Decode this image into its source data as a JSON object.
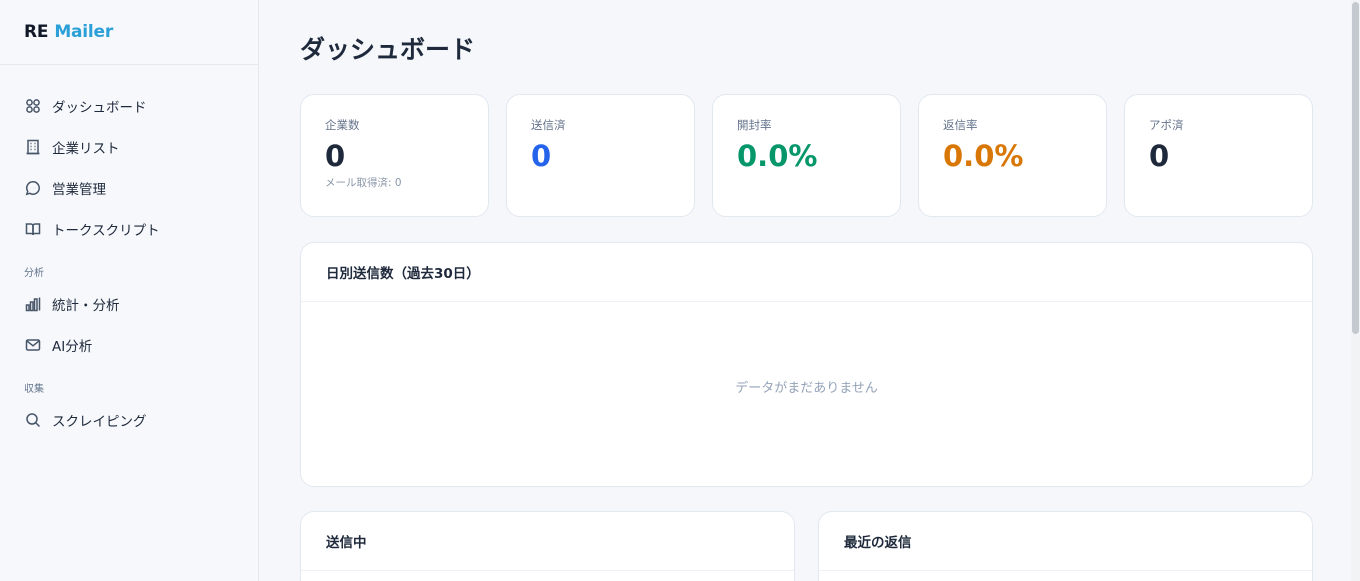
{
  "brand": {
    "part1": "RE",
    "part2": "Mailer"
  },
  "sidebar": {
    "items": [
      {
        "label": "ダッシュボード",
        "icon": "dashboard-grid-icon"
      },
      {
        "label": "企業リスト",
        "icon": "building-icon"
      },
      {
        "label": "営業管理",
        "icon": "chat-bubble-icon"
      },
      {
        "label": "トークスクリプト",
        "icon": "book-icon"
      }
    ],
    "section_analysis": "分析",
    "analysis_items": [
      {
        "label": "統計・分析",
        "icon": "bar-chart-icon"
      },
      {
        "label": "AI分析",
        "icon": "mail-icon"
      }
    ],
    "section_collect": "収集",
    "collect_items": [
      {
        "label": "スクレイピング",
        "icon": "search-icon"
      }
    ]
  },
  "page": {
    "title": "ダッシュボード"
  },
  "stats": [
    {
      "label": "企業数",
      "value": "0",
      "sub": "メール取得済: 0",
      "color": "#1e293b"
    },
    {
      "label": "送信済",
      "value": "0",
      "sub": "",
      "color": "#2563eb"
    },
    {
      "label": "開封率",
      "value": "0.0%",
      "sub": "",
      "color": "#059669"
    },
    {
      "label": "返信率",
      "value": "0.0%",
      "sub": "",
      "color": "#d97706"
    },
    {
      "label": "アポ済",
      "value": "0",
      "sub": "",
      "color": "#1e293b"
    }
  ],
  "daily_chart": {
    "title": "日別送信数（過去30日）",
    "empty_text": "データがまだありません"
  },
  "sending_panel": {
    "title": "送信中"
  },
  "replies_panel": {
    "title": "最近の返信"
  }
}
